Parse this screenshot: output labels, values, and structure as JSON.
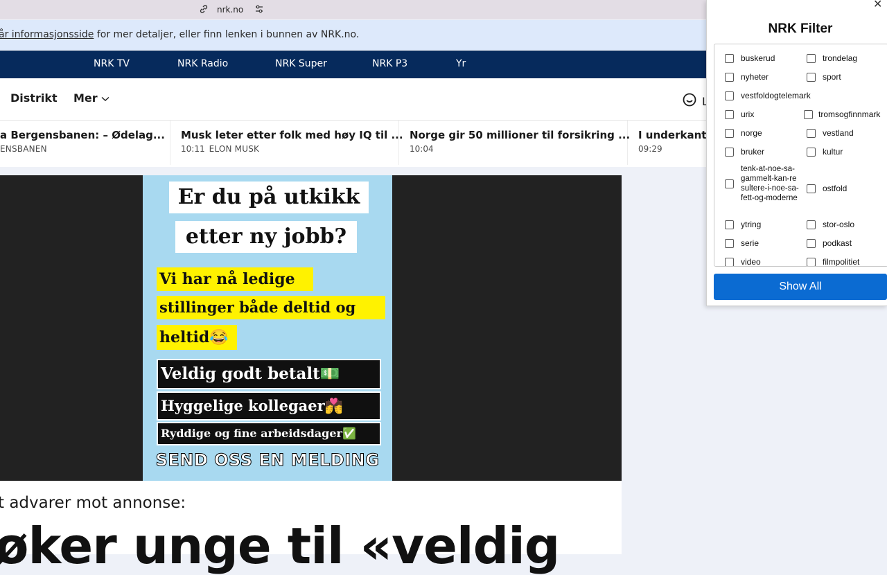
{
  "browser": {
    "url": "nrk.no",
    "link_icon": "link-icon",
    "tune_icon": "tune-icon"
  },
  "info_banner": {
    "link_text": "år informasjonsside",
    "rest_text": " for mer detaljer, eller finn lenken i bunnen av NRK.no."
  },
  "top_nav": [
    "NRK TV",
    "NRK Radio",
    "NRK Super",
    "NRK P3",
    "Yr"
  ],
  "sub_nav": {
    "distrikt": "Distrikt",
    "mer": "Mer",
    "login_partial": "L"
  },
  "ticker": [
    {
      "title": "a Bergensbanen: – Ødelag...",
      "time": "",
      "tag": "ENSBANEN"
    },
    {
      "title": "Musk leter etter folk med høy IQ til ...",
      "time": "10:11",
      "tag": "ELON MUSK"
    },
    {
      "title": "Norge gir 50 millioner til forsikring ...",
      "time": "10:04",
      "tag": ""
    },
    {
      "title": "I underkant av",
      "time": "09:29",
      "tag": ""
    }
  ],
  "poster": {
    "line1": "Er du på utkikk",
    "line2": "etter ny jobb?",
    "line3": "Vi har nå ledige",
    "line4": "stillinger både deltid og",
    "line5": "heltid😂",
    "line6": "Veldig godt betalt💵",
    "line7": "Hyggelige kollegaer💏",
    "line8": "Ryddige og fine arbeidsdager✅",
    "line9": "SEND OSS EN MELDING"
  },
  "article": {
    "kicker": "t advarer mot annonse:",
    "headline": "øker unge til «veldig"
  },
  "filter_panel": {
    "title": "NRK Filter",
    "left": [
      "buskerud",
      "nyheter",
      "vestfoldogtelemark",
      "urix",
      "norge",
      "bruker",
      "tenk-at-noe-sa-gammelt-kan-resultere-i-noe-sa-fett-og-moderne",
      "ytring",
      "serie",
      "video"
    ],
    "right": [
      "trondelag",
      "sport",
      "",
      "tromsogfinnmark",
      "vestland",
      "kultur",
      "ostfold",
      "stor-oslo",
      "podkast",
      "filmpolitiet"
    ],
    "button": "Show All"
  }
}
